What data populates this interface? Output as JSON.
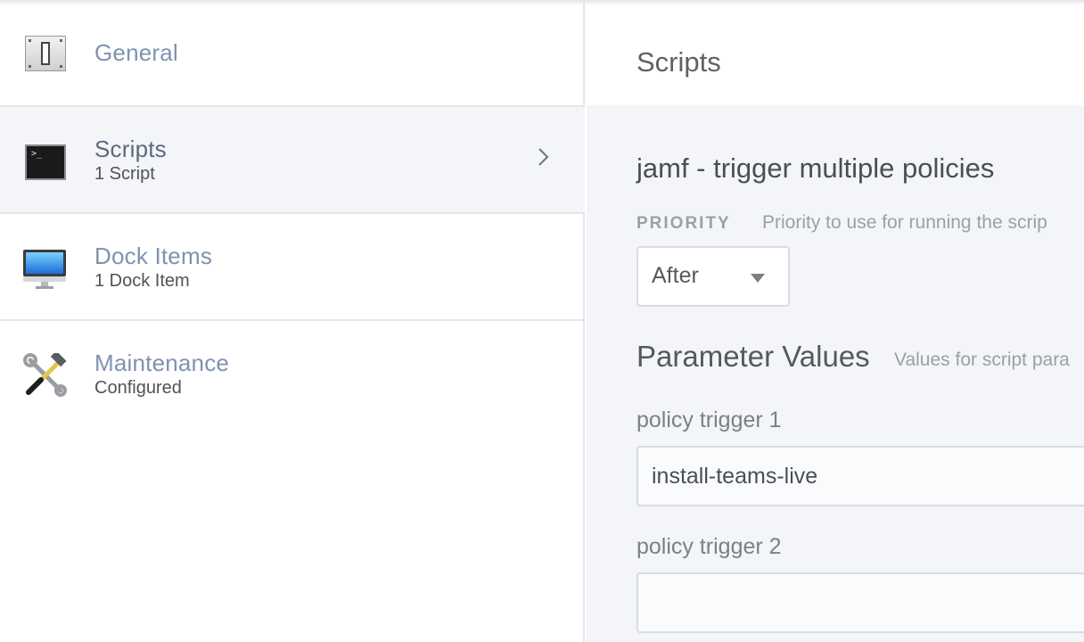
{
  "sidebar": {
    "items": [
      {
        "title": "General",
        "subtitle": "",
        "icon": "toggle-switch-icon"
      },
      {
        "title": "Scripts",
        "subtitle": "1 Script",
        "icon": "terminal-icon",
        "active": true
      },
      {
        "title": "Dock Items",
        "subtitle": "1 Dock Item",
        "icon": "monitor-icon"
      },
      {
        "title": "Maintenance",
        "subtitle": "Configured",
        "icon": "tools-icon"
      }
    ]
  },
  "main": {
    "title": "Scripts",
    "script_name": "jamf - trigger multiple policies",
    "priority": {
      "label": "PRIORITY",
      "help": "Priority to use for running the scrip",
      "value": "After"
    },
    "parameters": {
      "title": "Parameter Values",
      "help": "Values for script para",
      "fields": [
        {
          "label": "policy trigger 1",
          "value": "install-teams-live"
        },
        {
          "label": "policy trigger 2",
          "value": ""
        }
      ]
    }
  },
  "colors": {
    "sidebar_title": "#7f93ae",
    "active_bg": "#f4f5f8",
    "main_bg": "#f4f5f8"
  }
}
